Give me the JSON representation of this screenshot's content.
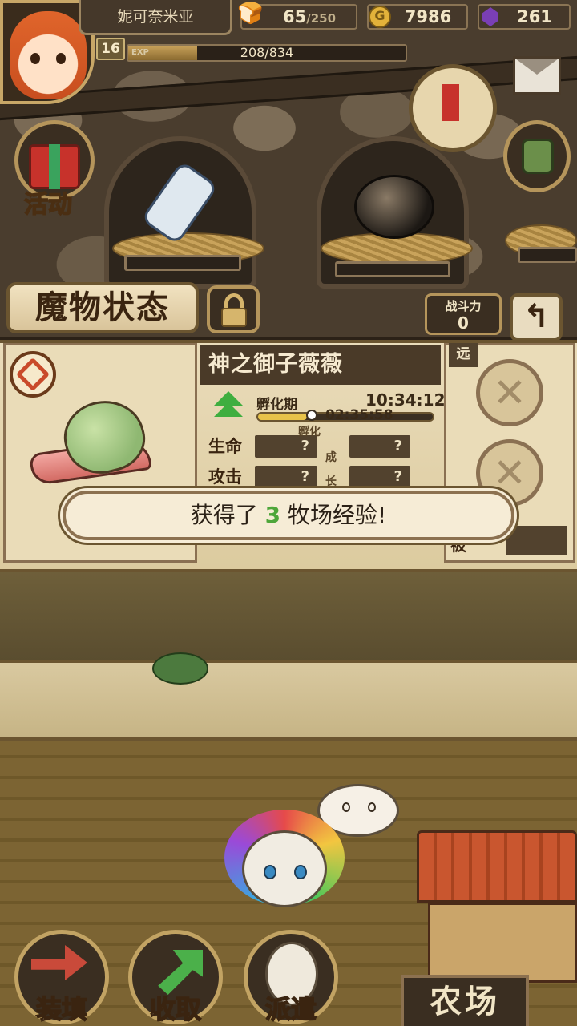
{
  "player": {
    "name": "妮可奈米亚",
    "level": "16",
    "exp_label": "EXP",
    "exp_value": "208/834",
    "exp_fraction": 0.249
  },
  "resources": {
    "stamina": "65",
    "stamina_max": "/250",
    "gold": "7986",
    "gems": "261"
  },
  "side_menu": {
    "event_label": "活动"
  },
  "header": {
    "title": "魔物状态",
    "power_label": "战斗力",
    "power_value": "0",
    "back_icon": "↰"
  },
  "monster": {
    "name": "神之御子薇薇",
    "stage_label": "孵化期",
    "stage_time": "10:34:12",
    "stage_remaining": "02:35:58",
    "stage_progress": 0.28,
    "stats": [
      {
        "label": "生命",
        "value": "?",
        "growth": "?"
      },
      {
        "label": "攻击",
        "value": "?",
        "growth": "?"
      }
    ],
    "side_label_top": "孵化",
    "side_label_bottom": "成长",
    "range_tag": "远",
    "range_tag_bottom": "被"
  },
  "toast": {
    "prefix": "获得了 ",
    "amount": "3",
    "suffix": " 牧场经验!"
  },
  "bottom_nav": {
    "load": "装填",
    "collect": "收取",
    "dispatch": "派遣",
    "farm": "农场"
  },
  "colors": {
    "accent_gold": "#c9a25a",
    "toast_number": "#4ea63a",
    "panel_bg": "#eadcba"
  }
}
